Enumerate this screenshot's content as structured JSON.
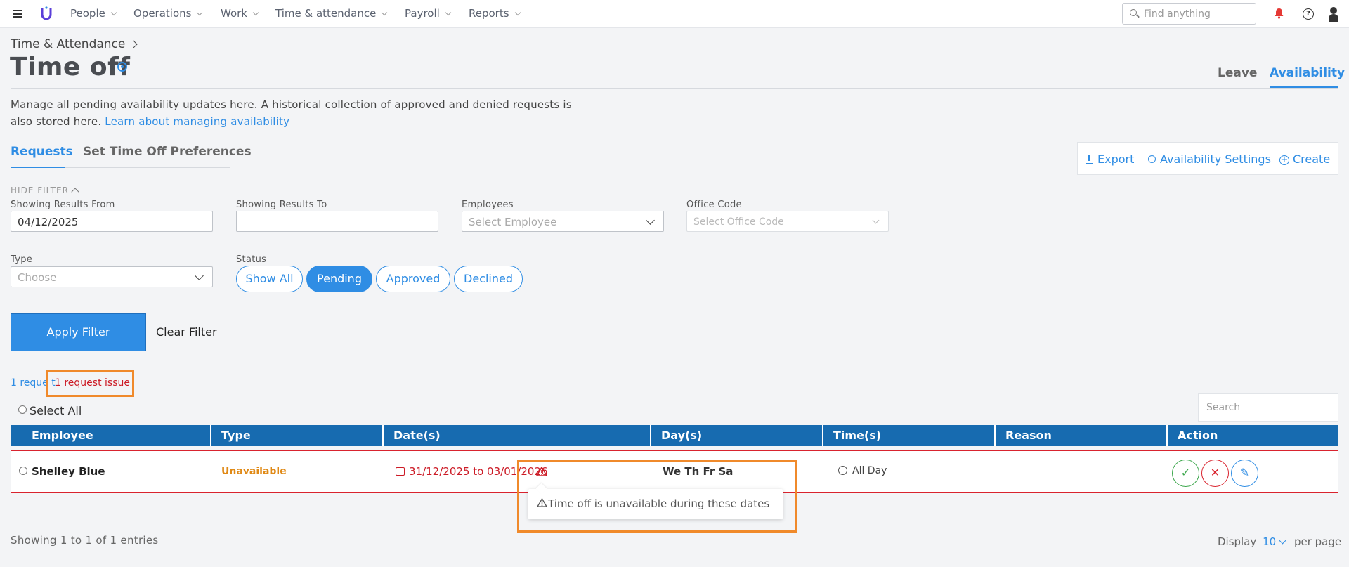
{
  "nav": {
    "items": [
      "People",
      "Operations",
      "Work",
      "Time & attendance",
      "Payroll",
      "Reports"
    ],
    "search_placeholder": "Find anything"
  },
  "header": {
    "breadcrumb": "Time & Attendance",
    "title": "Time off",
    "tabs": [
      "Leave",
      "Availability"
    ],
    "active_tab": "Availability"
  },
  "description": {
    "text": "Manage all pending availability updates here. A historical collection of approved and denied requests is also stored here.",
    "link": "Learn about managing availability"
  },
  "subtabs": {
    "requests": "Requests",
    "preferences": "Set Time Off Preferences"
  },
  "actions": {
    "export": "Export",
    "settings": "Availability Settings",
    "create": "Create"
  },
  "filter": {
    "hide_label": "HIDE FILTER",
    "from_label": "Showing Results From",
    "from_value": "04/12/2025",
    "to_label": "Showing Results To",
    "to_value": "",
    "employees_label": "Employees",
    "employees_placeholder": "Select Employee",
    "office_label": "Office Code",
    "office_placeholder": "Select Office Code",
    "type_label": "Type",
    "type_placeholder": "Choose",
    "status_label": "Status",
    "status_options": [
      "Show All",
      "Pending",
      "Approved",
      "Declined"
    ],
    "status_selected": "Pending",
    "apply": "Apply Filter",
    "clear": "Clear Filter"
  },
  "summary": {
    "count_text": "1 reque  t",
    "issue_text": "1 request issue"
  },
  "table": {
    "select_all": "Select All",
    "search_placeholder": "Search",
    "headers": [
      "Employee",
      "Type",
      "Date(s)",
      "Day(s)",
      "Time(s)",
      "Reason",
      "Action"
    ],
    "rows": [
      {
        "employee": "Shelley Blue",
        "type": "Unavailable",
        "dates": "31/12/2025 to 03/01/2026",
        "days": "We Th Fr Sa",
        "times": "All Day",
        "reason": ""
      }
    ],
    "tooltip": "Time off is unavailable during these dates",
    "footer_showing": "Showing 1 to 1 of 1 entries",
    "display_label": "Display",
    "display_value": "10",
    "per_page": "per page"
  },
  "colors": {
    "accent": "#2f8de4",
    "header_blue": "#176bb0",
    "error": "#cc1b26",
    "warning": "#e08a17",
    "success": "#3aa64a",
    "highlight": "#f08a2b"
  }
}
